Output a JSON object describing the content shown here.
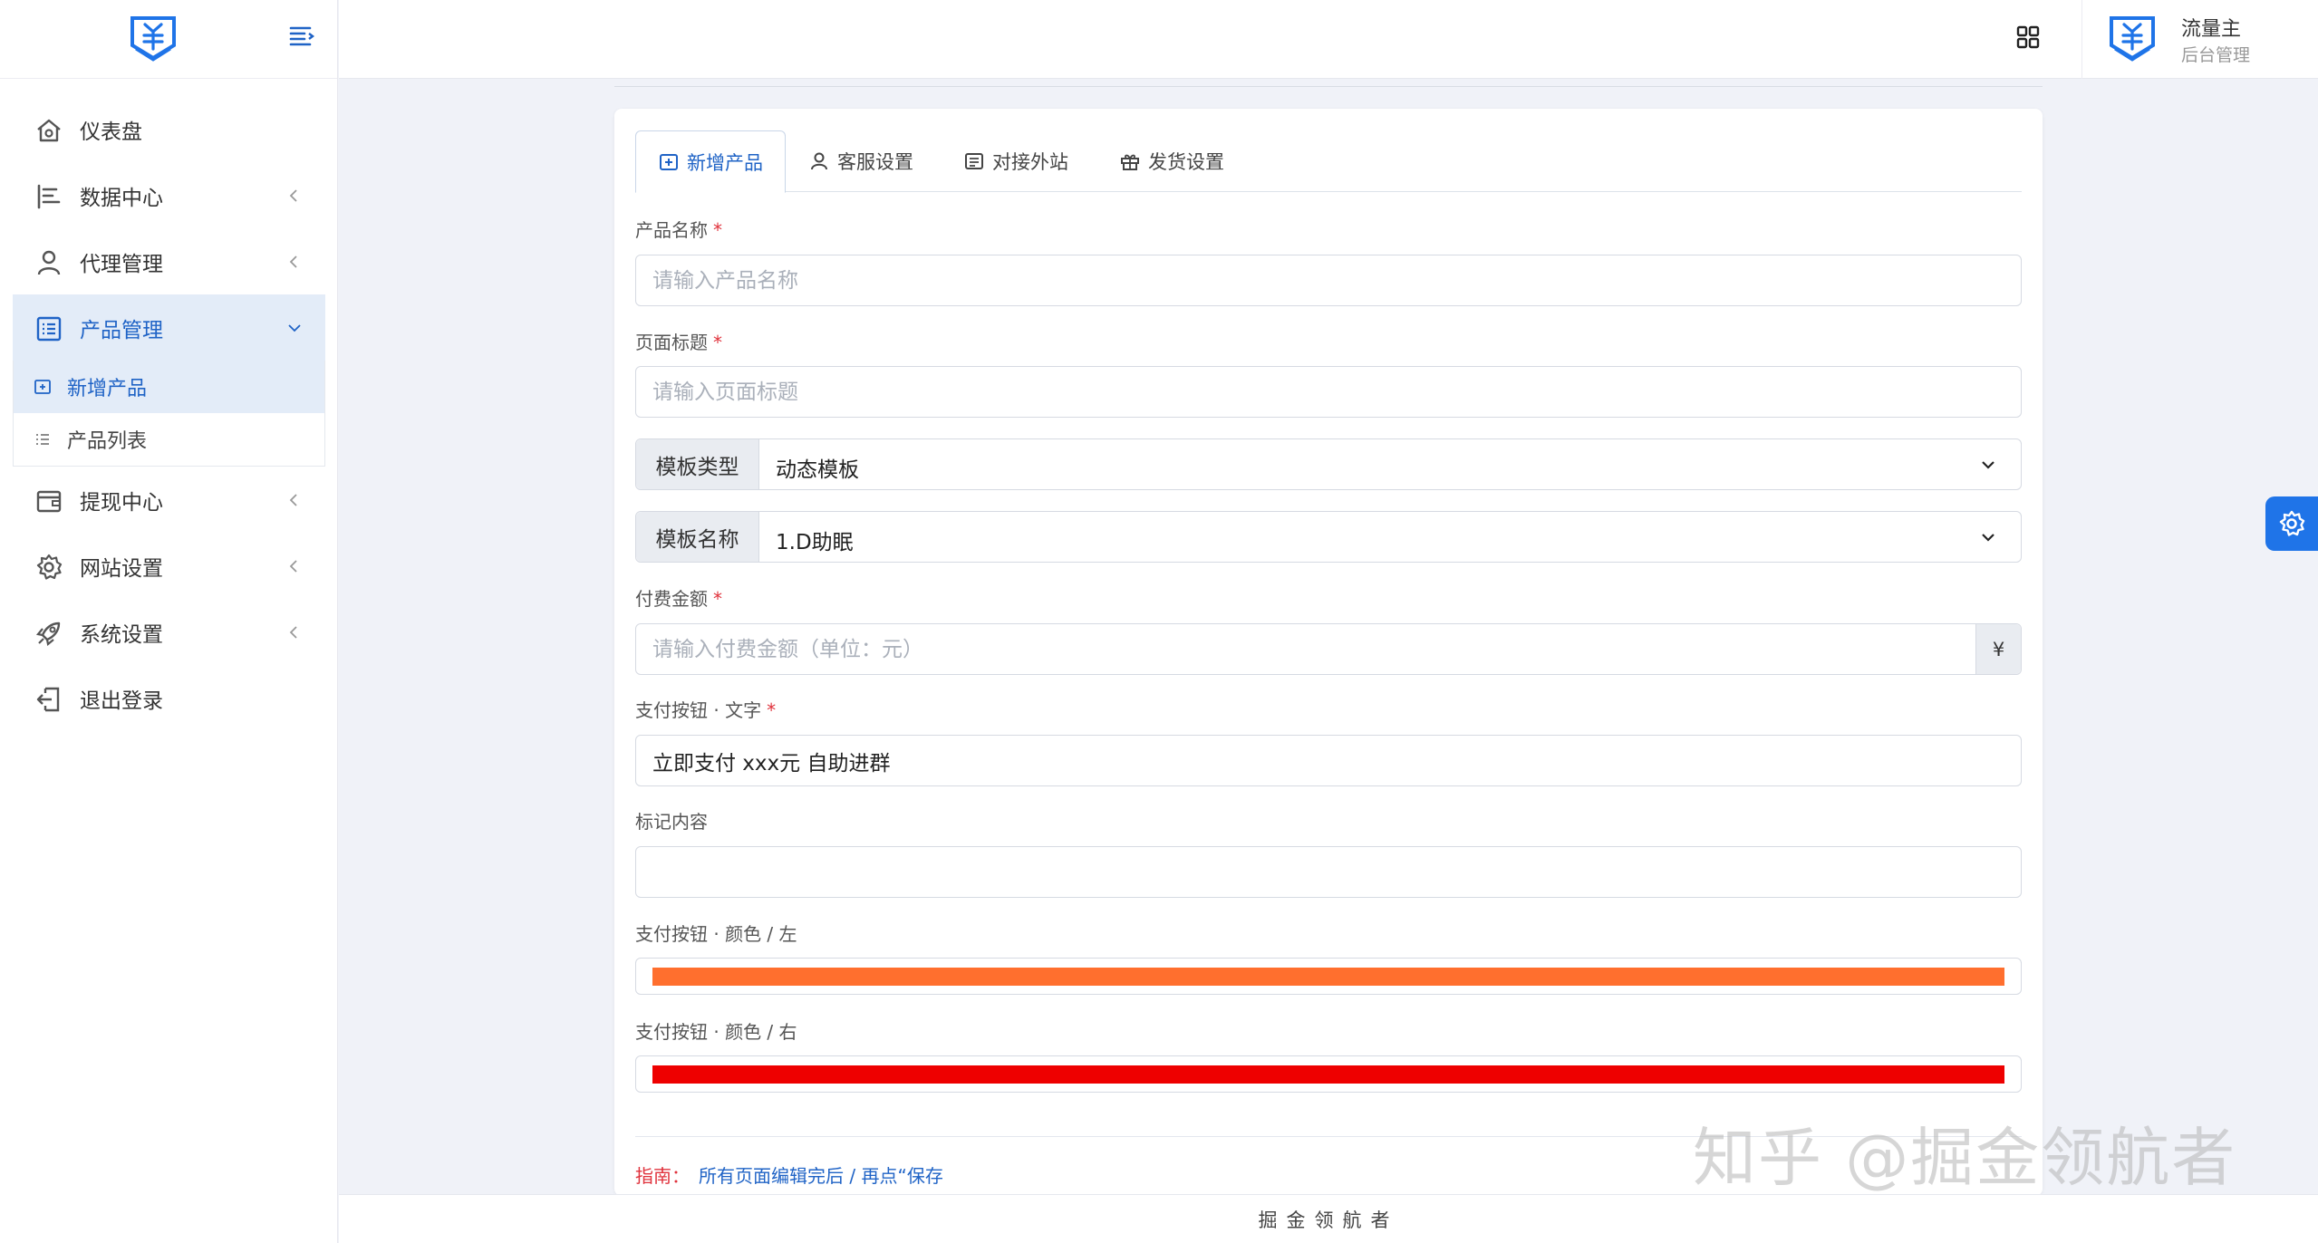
{
  "sidebar": {
    "items": [
      {
        "label": "仪表盘",
        "icon": "home-icon"
      },
      {
        "label": "数据中心",
        "icon": "bar-chart-icon"
      },
      {
        "label": "代理管理",
        "icon": "user-icon"
      },
      {
        "label": "产品管理",
        "icon": "list-icon"
      },
      {
        "label": "提现中心",
        "icon": "wallet-icon"
      },
      {
        "label": "网站设置",
        "icon": "gear-icon"
      },
      {
        "label": "系统设置",
        "icon": "rocket-icon"
      },
      {
        "label": "退出登录",
        "icon": "logout-icon"
      }
    ],
    "submenu": [
      {
        "label": "新增产品"
      },
      {
        "label": "产品列表"
      }
    ]
  },
  "header": {
    "user_name": "流量主",
    "user_role": "后台管理"
  },
  "tabs": [
    {
      "label": "新增产品"
    },
    {
      "label": "客服设置"
    },
    {
      "label": "对接外站"
    },
    {
      "label": "发货设置"
    }
  ],
  "form": {
    "product_name": {
      "label": "产品名称",
      "required": "*",
      "placeholder": "请输入产品名称"
    },
    "page_title": {
      "label": "页面标题",
      "required": "*",
      "placeholder": "请输入页面标题"
    },
    "template_type": {
      "addon": "模板类型",
      "value": "动态模板"
    },
    "template_name": {
      "addon": "模板名称",
      "value": "1.D助眠"
    },
    "amount": {
      "label": "付费金额",
      "required": "*",
      "placeholder": "请输入付费金额（单位：元）",
      "unit": "¥"
    },
    "pay_text": {
      "label": "支付按钮 · 文字",
      "required": "*",
      "value": "立即支付 xxx元 自助进群"
    },
    "mark": {
      "label": "标记内容",
      "value": ""
    },
    "color_left": {
      "label": "支付按钮 · 颜色 / 左",
      "color": "#ff6f2e"
    },
    "color_right": {
      "label": "支付按钮 · 颜色 / 右",
      "color": "#ee0000"
    }
  },
  "guide": {
    "label": "指南：",
    "text": "所有页面编辑完后 / 再点“保存"
  },
  "footer": {
    "text": "掘金领航者"
  },
  "watermark": {
    "text": "知乎 @掘金领航者"
  },
  "colors": {
    "accent": "#1f63c6",
    "float_button": "#1f74e8",
    "required": "#e0323c"
  }
}
